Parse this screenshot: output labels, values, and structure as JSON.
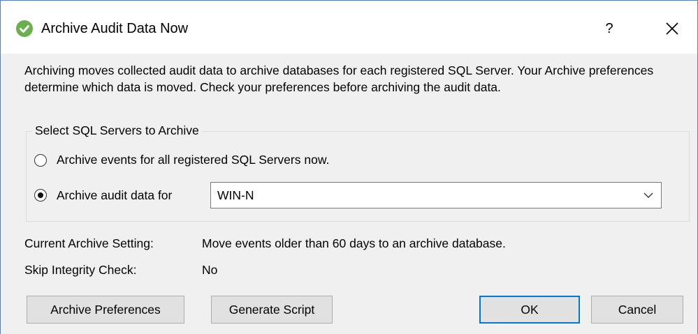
{
  "window": {
    "title": "Archive Audit Data Now",
    "help_label": "?",
    "icon": "green-check-circle-icon",
    "accent_color": "#0078d7"
  },
  "description": "Archiving moves collected audit data to archive databases for each registered SQL Server. Your Archive preferences determine which data is moved. Check your preferences before archiving the audit data.",
  "server_selection": {
    "group_label": "Select SQL Servers to Archive",
    "option_all_label": "Archive events for all registered SQL Servers now.",
    "option_all_selected": false,
    "option_specific_label": "Archive audit data for",
    "option_specific_selected": true,
    "selected_server": "WIN-N"
  },
  "info": {
    "archive_setting_label": "Current Archive Setting:",
    "archive_setting_value": "Move events older than 60 days to an archive database.",
    "skip_integrity_label": "Skip Integrity Check:",
    "skip_integrity_value": "No"
  },
  "buttons": {
    "preferences_label": "Archive Preferences",
    "script_label": "Generate Script",
    "ok_label": "OK",
    "cancel_label": "Cancel"
  }
}
